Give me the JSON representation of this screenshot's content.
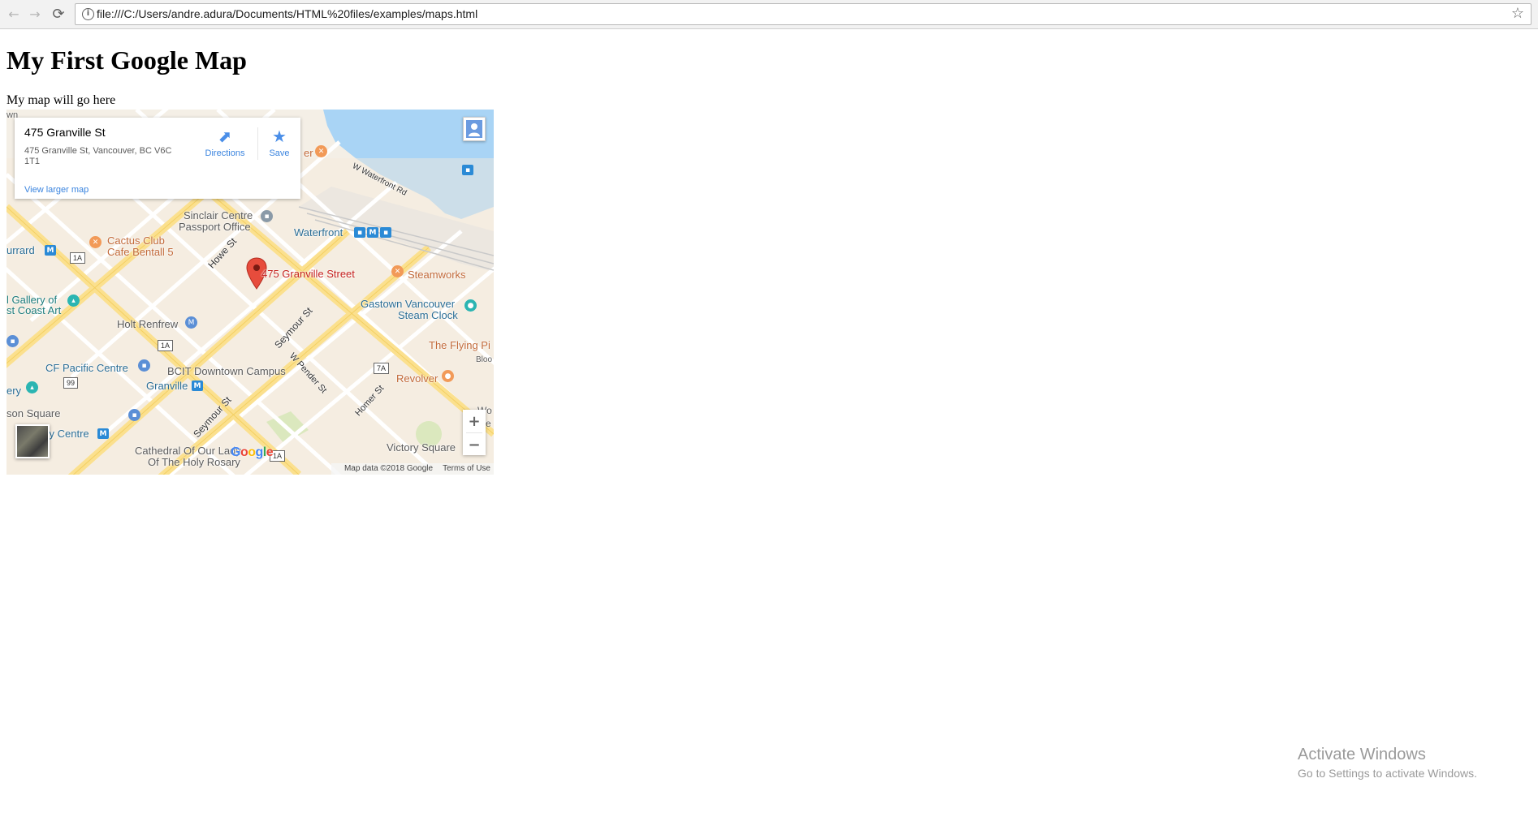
{
  "browser": {
    "url": "file:///C:/Users/andre.adura/Documents/HTML%20files/examples/maps.html",
    "info_icon": "i",
    "back_icon": "←",
    "forward_icon": "→",
    "reload_icon": "⟳",
    "bookmark_icon": "☆"
  },
  "page": {
    "title": "My First Google Map",
    "intro": "My map will go here"
  },
  "map": {
    "info_card": {
      "title": "475 Granville St",
      "address": "475 Granville St, Vancouver, BC V6C 1T1",
      "directions_label": "Directions",
      "save_label": "Save",
      "view_larger_label": "View larger map"
    },
    "marker_label": "475 Granville Street",
    "labels": {
      "sinclair": "Sinclair Centre",
      "passport": "Passport Office",
      "waterfront": "Waterfront",
      "cactus1": "Cactus Club",
      "cactus2": "Cafe Bentall 5",
      "burrard": "urrard",
      "gallery1": "l Gallery of",
      "gallery2": "st Coast Art",
      "holt": "Holt Renfrew",
      "steamworks": "Steamworks",
      "gastown1": "Gastown Vancouver",
      "gastown2": "Steam Clock",
      "flying": "The Flying Pi",
      "cf_pacific": "CF Pacific Centre",
      "bcit": "BCIT Downtown Campus",
      "granville": "Granville",
      "revolver": "Revolver",
      "ery": "ery",
      "son_square": "son Square",
      "city_centre": "ity Centre",
      "cathedral1": "Cathedral Of Our Lady",
      "cathedral2": "Of The Holy Rosary",
      "victory": "Victory Square",
      "wn": "wn",
      "w_waterfront": "W Waterfront Rd",
      "howe": "Howe St",
      "seymour1": "Seymour St",
      "seymour2": "Seymour St",
      "w_pender": "W Pender St",
      "homer": "Homer St",
      "bloo": "Bloo",
      "wo": "Wo",
      "ve": "ve",
      "sh_1a_1": "1A",
      "sh_1a_2": "1A",
      "sh_1a_3": "1A",
      "sh_99": "99",
      "sh_7a": "7A"
    },
    "transit_m": "M",
    "zoom_in": "+",
    "zoom_out": "−",
    "google_logo": "Google",
    "attribution_data": "Map data ©2018 Google",
    "attribution_terms": "Terms of Use"
  },
  "watermark": {
    "title": "Activate Windows",
    "subtitle": "Go to Settings to activate Windows."
  }
}
